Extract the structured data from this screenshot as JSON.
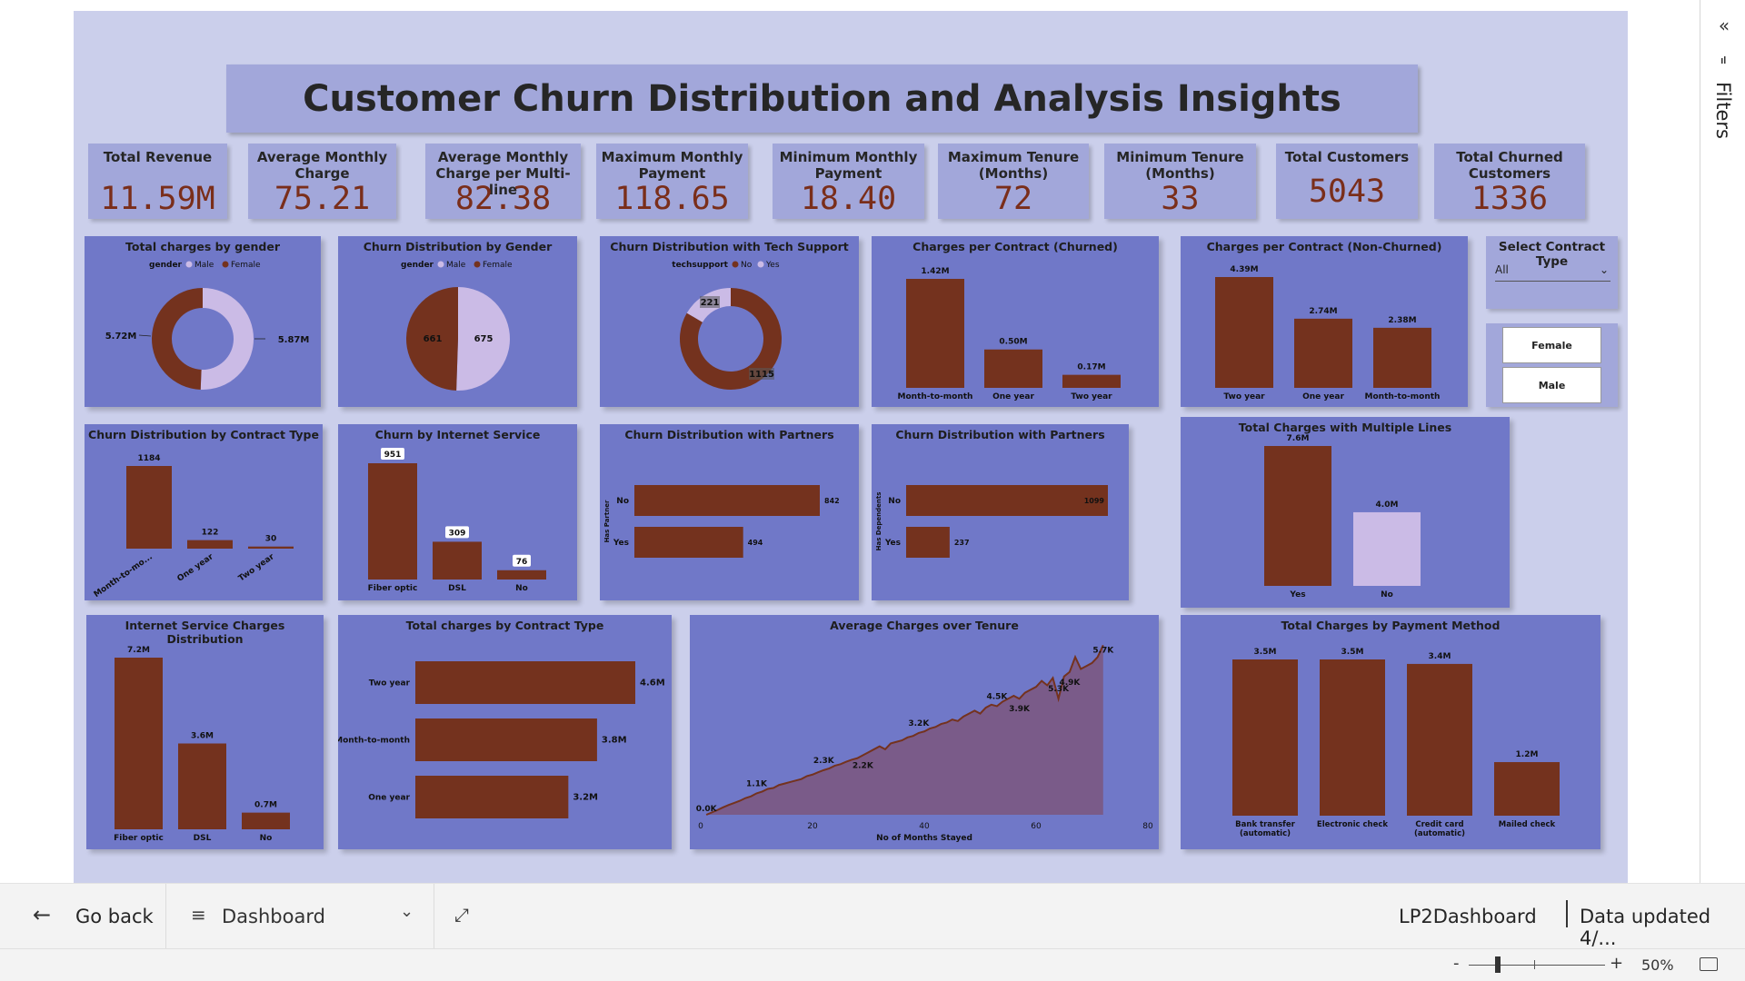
{
  "report": {
    "title": "Customer Churn Distribution and Analysis Insights"
  },
  "kpis": [
    {
      "label": "Total Revenue",
      "value": "11.59M"
    },
    {
      "label": "Average Monthly Charge",
      "value": "75.21"
    },
    {
      "label": "Average Monthly Charge per Multi-line",
      "value": "82.38"
    },
    {
      "label": "Maximum Monthly Payment",
      "value": "118.65"
    },
    {
      "label": "Minimum Monthly Payment",
      "value": "18.40"
    },
    {
      "label": "Maximum Tenure (Months)",
      "value": "72"
    },
    {
      "label": "Minimum Tenure (Months)",
      "value": "33"
    },
    {
      "label": "Total Customers",
      "value": "5043"
    },
    {
      "label": "Total Churned Customers",
      "value": "1336"
    }
  ],
  "slicers": {
    "contract_title": "Select Contract Type",
    "contract_value": "All",
    "gender_options": [
      "Female",
      "Male"
    ]
  },
  "colors": {
    "primary": "#74321e",
    "secondary": "#cbbbe6",
    "card": "#7078c8",
    "page": "#cbcfeb"
  },
  "chart_data": [
    {
      "id": "gender-charges",
      "type": "donut",
      "title": "Total charges by gender",
      "legend_title": "gender",
      "categories": [
        "Male",
        "Female"
      ],
      "values": [
        5.87,
        5.72
      ],
      "labels": [
        "5.87M",
        "5.72M"
      ]
    },
    {
      "id": "gender-churn",
      "type": "pie",
      "title": "Churn Distribution by Gender",
      "legend_title": "gender",
      "categories": [
        "Male",
        "Female"
      ],
      "values": [
        675,
        661
      ],
      "labels": [
        "675",
        "661"
      ]
    },
    {
      "id": "tech-support",
      "type": "donut",
      "title": "Churn Distribution with Tech Support",
      "legend_title": "techsupport",
      "categories": [
        "No",
        "Yes"
      ],
      "values": [
        1115,
        221
      ],
      "labels": [
        "1115",
        "221"
      ]
    },
    {
      "id": "contract-churned",
      "type": "bar",
      "title": "Charges per Contract (Churned)",
      "categories": [
        "Month-to-month",
        "One year",
        "Two year"
      ],
      "values": [
        1.42,
        0.5,
        0.17
      ],
      "labels": [
        "1.42M",
        "0.50M",
        "0.17M"
      ]
    },
    {
      "id": "contract-nonchurned",
      "type": "bar",
      "title": "Charges per Contract (Non-Churned)",
      "categories": [
        "Two year",
        "One year",
        "Month-to-month"
      ],
      "values": [
        4.39,
        2.74,
        2.38
      ],
      "labels": [
        "4.39M",
        "2.74M",
        "2.38M"
      ]
    },
    {
      "id": "churn-contract",
      "type": "bar",
      "title": "Churn Distribution by Contract Type",
      "categories": [
        "Month-to-mo...",
        "One year",
        "Two year"
      ],
      "values": [
        1184,
        122,
        30
      ],
      "labels": [
        "1184",
        "122",
        "30"
      ]
    },
    {
      "id": "churn-internet",
      "type": "bar",
      "title": "Churn by Internet Service",
      "categories": [
        "Fiber optic",
        "DSL",
        "No"
      ],
      "values": [
        951,
        309,
        76
      ],
      "labels": [
        "951",
        "309",
        "76"
      ]
    },
    {
      "id": "churn-partners",
      "type": "hbar",
      "title": "Churn Distribution with Partners",
      "axis_title": "Has Partner",
      "categories": [
        "No",
        "Yes"
      ],
      "values": [
        842,
        494
      ],
      "labels": [
        "842",
        "494"
      ]
    },
    {
      "id": "churn-dependents",
      "type": "hbar",
      "title": "Churn Distribution with Partners",
      "axis_title": "Has Dependents",
      "categories": [
        "No",
        "Yes"
      ],
      "values": [
        1099,
        237
      ],
      "labels": [
        "1099",
        "237"
      ]
    },
    {
      "id": "multiple-lines",
      "type": "bar",
      "title": "Total Charges with Multiple Lines",
      "categories": [
        "Yes",
        "No"
      ],
      "values": [
        7.6,
        4.0
      ],
      "labels": [
        "7.6M",
        "4.0M"
      ]
    },
    {
      "id": "internet-charges",
      "type": "bar",
      "title": "Internet Service Charges Distribution",
      "categories": [
        "Fiber optic",
        "DSL",
        "No"
      ],
      "values": [
        7.2,
        3.6,
        0.7
      ],
      "labels": [
        "7.2M",
        "3.6M",
        "0.7M"
      ]
    },
    {
      "id": "contract-charges",
      "type": "hbar",
      "title": "Total charges by Contract Type",
      "categories": [
        "Two year",
        "Month-to-month",
        "One year"
      ],
      "values": [
        4.6,
        3.8,
        3.2
      ],
      "labels": [
        "4.6M",
        "3.8M",
        "3.2M"
      ]
    },
    {
      "id": "tenure-area",
      "type": "area",
      "title": "Average Charges over Tenure",
      "xlabel": "No of Months Stayed",
      "xlim": [
        0,
        80
      ],
      "xticks": [
        "0",
        "20",
        "40",
        "60",
        "80"
      ],
      "x": [
        1,
        2,
        3,
        4,
        5,
        6,
        7,
        8,
        9,
        10,
        11,
        12,
        13,
        14,
        15,
        16,
        17,
        18,
        19,
        20,
        21,
        22,
        23,
        24,
        25,
        26,
        27,
        28,
        29,
        30,
        31,
        32,
        33,
        34,
        35,
        36,
        37,
        38,
        39,
        40,
        41,
        42,
        43,
        44,
        45,
        46,
        47,
        48,
        49,
        50,
        51,
        52,
        53,
        54,
        55,
        56,
        57,
        58,
        59,
        60,
        61,
        62,
        63,
        64,
        65,
        66,
        67,
        68,
        69,
        70,
        71,
        72
      ],
      "y": [
        0,
        80,
        160,
        250,
        330,
        400,
        470,
        560,
        620,
        720,
        780,
        870,
        900,
        1000,
        1050,
        1100,
        1150,
        1200,
        1300,
        1350,
        1430,
        1500,
        1560,
        1650,
        1700,
        1780,
        1850,
        1900,
        2000,
        2100,
        2200,
        2300,
        2200,
        2400,
        2450,
        2500,
        2600,
        2650,
        2750,
        2800,
        2900,
        2950,
        3050,
        3100,
        3200,
        3150,
        3300,
        3400,
        3500,
        3400,
        3600,
        3700,
        3650,
        3800,
        3900,
        4000,
        3900,
        4100,
        4200,
        4300,
        4500,
        4350,
        4600,
        3900,
        4650,
        4800,
        5300,
        4900,
        5000,
        5100,
        5300,
        5700
      ],
      "annotations": [
        "0.0K",
        "1.1K",
        "2.3K",
        "2.2K",
        "3.2K",
        "4.5K",
        "3.9K",
        "5.3K",
        "4.9K",
        "5.7K"
      ]
    },
    {
      "id": "payment-method",
      "type": "bar",
      "title": "Total Charges by Payment Method",
      "categories": [
        "Bank transfer (automatic)",
        "Electronic check",
        "Credit card (automatic)",
        "Mailed check"
      ],
      "values": [
        3.5,
        3.5,
        3.4,
        1.2
      ],
      "labels": [
        "3.5M",
        "3.5M",
        "3.4M",
        "1.2M"
      ]
    }
  ],
  "app": {
    "go_back": "Go back",
    "page_name": "Dashboard",
    "report_name": "LP2Dashboard",
    "data_updated": "Data updated 4/...",
    "filters_label": "Filters",
    "zoom": "50%",
    "zoom_minus": "-",
    "zoom_plus": "+"
  }
}
